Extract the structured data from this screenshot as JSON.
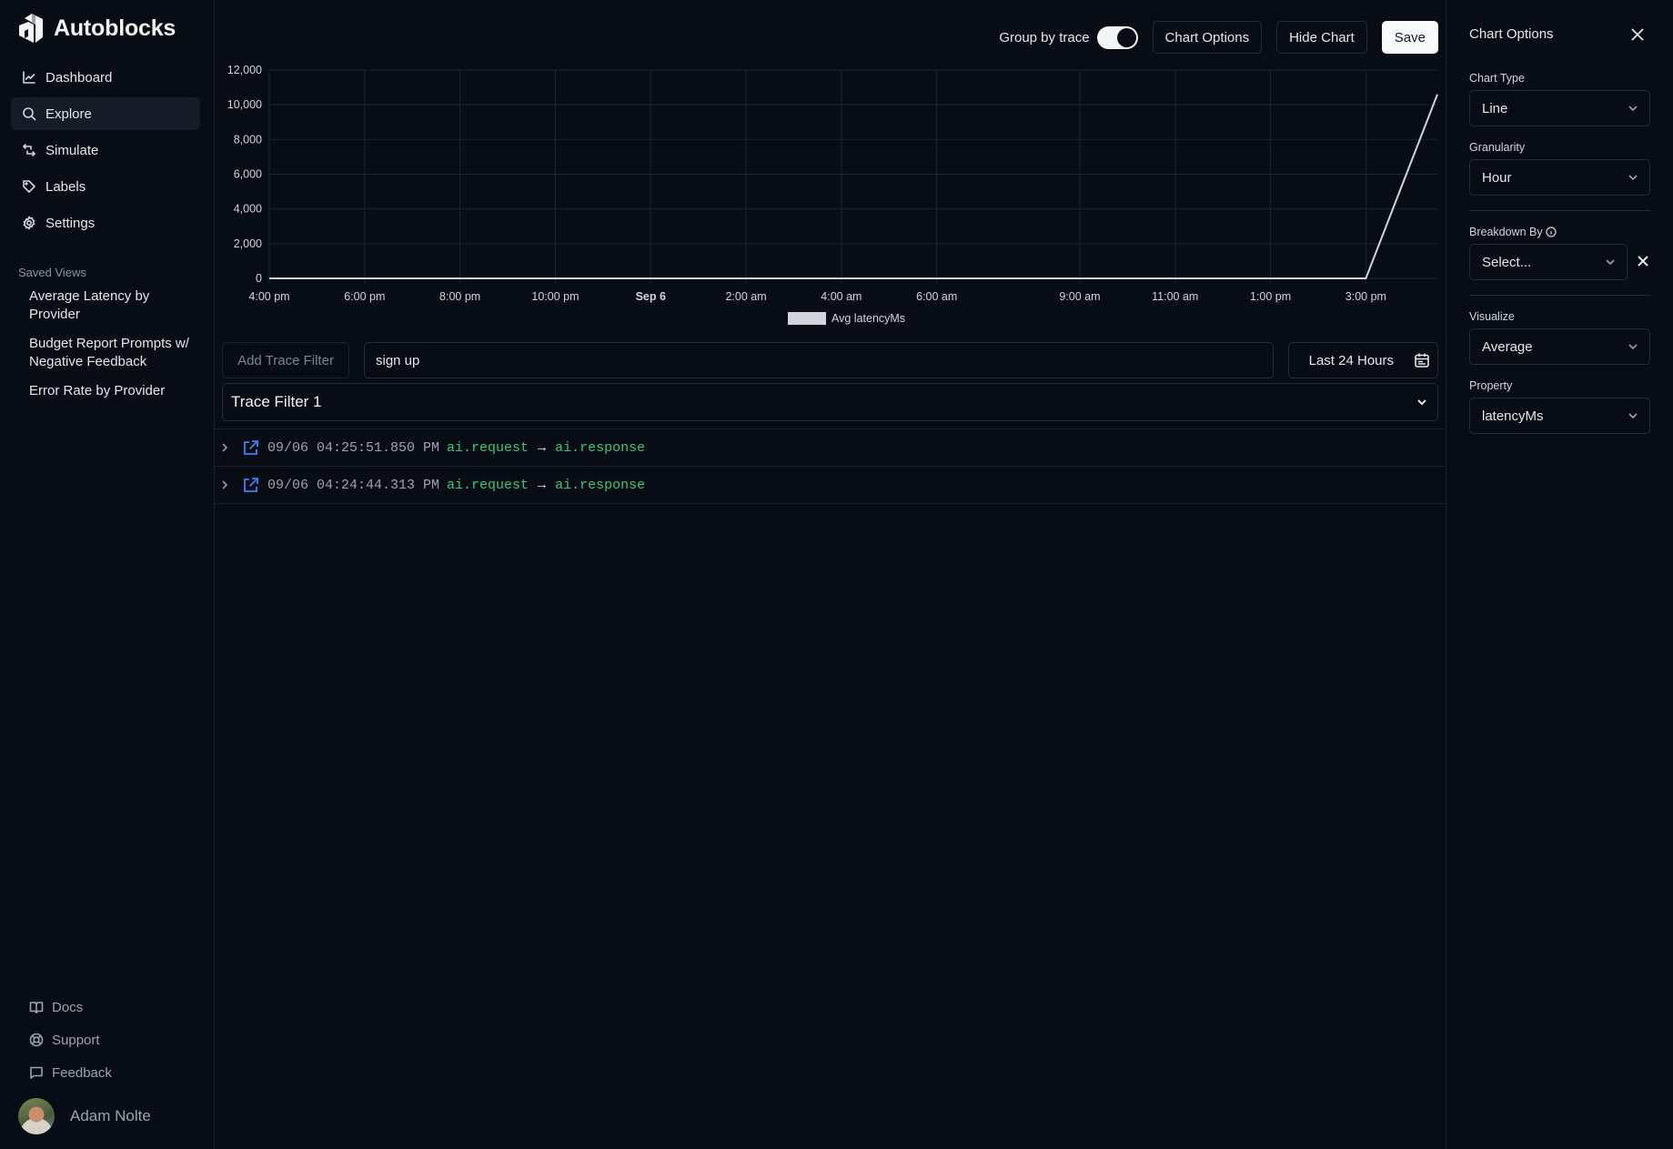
{
  "app": {
    "name": "Autoblocks"
  },
  "sidebar": {
    "nav": [
      {
        "label": "Dashboard",
        "icon": "chart-line-icon",
        "active": false
      },
      {
        "label": "Explore",
        "icon": "search-icon",
        "active": true
      },
      {
        "label": "Simulate",
        "icon": "repeat-icon",
        "active": false
      },
      {
        "label": "Labels",
        "icon": "tag-icon",
        "active": false
      },
      {
        "label": "Settings",
        "icon": "gear-icon",
        "active": false
      }
    ],
    "saved_views_title": "Saved Views",
    "saved_views": [
      "Average Latency by Provider",
      "Budget Report Prompts w/ Negative Feedback",
      "Error Rate by Provider"
    ],
    "bottom": [
      {
        "label": "Docs",
        "icon": "book-icon"
      },
      {
        "label": "Support",
        "icon": "lifebuoy-icon"
      },
      {
        "label": "Feedback",
        "icon": "message-icon"
      }
    ],
    "user": {
      "name": "Adam Nolte"
    }
  },
  "toolbar": {
    "group_by_trace_label": "Group by trace",
    "group_by_trace_on": true,
    "chart_options_label": "Chart Options",
    "hide_chart_label": "Hide Chart",
    "save_label": "Save"
  },
  "chart_data": {
    "type": "line",
    "title": "",
    "xlabel": "",
    "ylabel": "",
    "ylim": [
      0,
      12000
    ],
    "y_ticks": [
      "0",
      "2,000",
      "4,000",
      "6,000",
      "8,000",
      "10,000",
      "12,000"
    ],
    "y_tick_values": [
      0,
      2000,
      4000,
      6000,
      8000,
      10000,
      12000
    ],
    "x_ticks": [
      {
        "label": "4:00 pm",
        "hour": 0,
        "bold": false
      },
      {
        "label": "6:00 pm",
        "hour": 2,
        "bold": false
      },
      {
        "label": "8:00 pm",
        "hour": 4,
        "bold": false
      },
      {
        "label": "10:00 pm",
        "hour": 6,
        "bold": false
      },
      {
        "label": "Sep 6",
        "hour": 8,
        "bold": true
      },
      {
        "label": "2:00 am",
        "hour": 10,
        "bold": false
      },
      {
        "label": "4:00 am",
        "hour": 12,
        "bold": false
      },
      {
        "label": "6:00 am",
        "hour": 14,
        "bold": false
      },
      {
        "label": "9:00 am",
        "hour": 17,
        "bold": false
      },
      {
        "label": "11:00 am",
        "hour": 19,
        "bold": false
      },
      {
        "label": "1:00 pm",
        "hour": 21,
        "bold": false
      },
      {
        "label": "3:00 pm",
        "hour": 23,
        "bold": false
      }
    ],
    "x_range_hours": [
      0,
      24.5
    ],
    "grid": true,
    "legend": {
      "position": "bottom-center",
      "entries": [
        "Avg latencyMs"
      ]
    },
    "series": [
      {
        "name": "Avg latencyMs",
        "color": "#d1d5db",
        "x_hours": [
          0,
          2,
          4,
          6,
          8,
          10,
          12,
          14,
          16,
          18,
          20,
          22,
          23,
          24.5
        ],
        "values": [
          0,
          0,
          0,
          0,
          0,
          0,
          0,
          0,
          0,
          0,
          0,
          0,
          0,
          10600
        ]
      }
    ]
  },
  "filters": {
    "add_trace_filter_label": "Add Trace Filter",
    "search_value": "sign up",
    "date_range_label": "Last 24 Hours",
    "trace_filter_label": "Trace Filter 1"
  },
  "traces": [
    {
      "timestamp": "09/06 04:25:51.850 PM",
      "from": "ai.request",
      "arrow": "→",
      "to": "ai.response"
    },
    {
      "timestamp": "09/06 04:24:44.313 PM",
      "from": "ai.request",
      "arrow": "→",
      "to": "ai.response"
    }
  ],
  "chart_options": {
    "title": "Chart Options",
    "chart_type_label": "Chart Type",
    "chart_type_value": "Line",
    "granularity_label": "Granularity",
    "granularity_value": "Hour",
    "breakdown_label": "Breakdown By",
    "breakdown_placeholder": "Select...",
    "visualize_label": "Visualize",
    "visualize_value": "Average",
    "property_label": "Property",
    "property_value": "latencyMs"
  }
}
